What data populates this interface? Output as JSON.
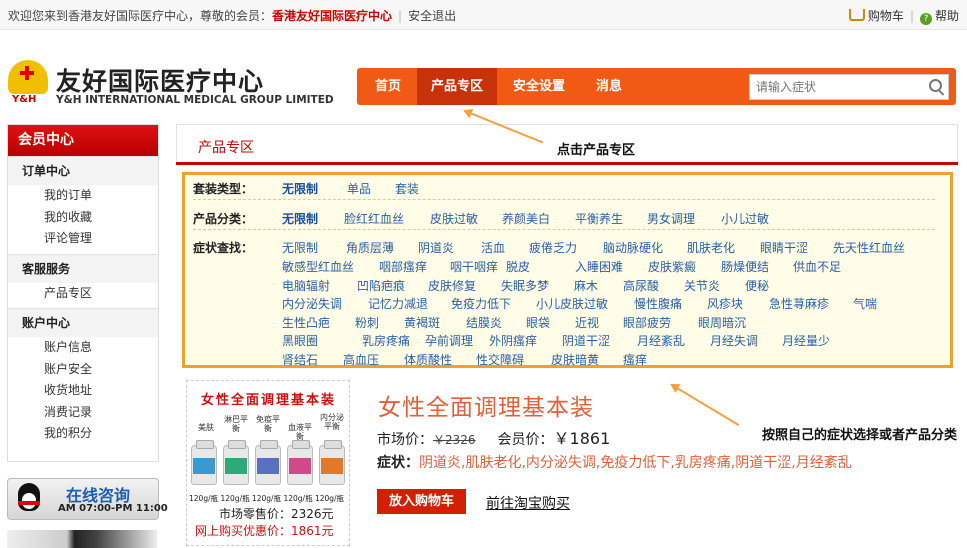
{
  "topbar": {
    "welcome": "欢迎您来到香港友好国际医疗中心，尊敬的会员：",
    "member": "香港友好国际医疗中心",
    "logout": "安全退出",
    "cart": "购物车",
    "help": "帮助",
    "cart_icon": "cart-icon",
    "help_icon": "help-icon"
  },
  "logo": {
    "cn": "友好国际医疗中心",
    "en": "Y&H INTERNATIONAL MEDICAL GROUP LIMITED",
    "mark": "Y&H"
  },
  "nav": {
    "tabs": [
      "首页",
      "产品专区",
      "安全设置",
      "消息"
    ],
    "active_tab": "产品专区",
    "search_placeholder": "请输入症状"
  },
  "sidebar": {
    "title": "会员中心",
    "sections": [
      {
        "title": "订单中心",
        "items": [
          "我的订单",
          "我的收藏",
          "评论管理"
        ]
      },
      {
        "title": "客服服务",
        "items": [
          "产品专区"
        ]
      },
      {
        "title": "账户中心",
        "items": [
          "账户信息",
          "账户安全",
          "收货地址",
          "消费记录",
          "我的积分"
        ]
      }
    ]
  },
  "consult": {
    "title": "在线咨询",
    "hours": "AM 07:00-PM 11:00"
  },
  "section": {
    "title": "产品专区"
  },
  "annotations": {
    "click_tab": "点击产品专区",
    "choose": "按照自己的症状选择或者产品分类"
  },
  "filters": {
    "package_type": {
      "label": "套装类型：",
      "options": [
        "无限制",
        "单品",
        "套装"
      ]
    },
    "category": {
      "label": "产品分类：",
      "options": [
        "无限制",
        "脸红红血丝",
        "皮肤过敏",
        "养颜美白",
        "平衡养生",
        "男女调理",
        "小儿过敏"
      ]
    },
    "symptom": {
      "label": "症状查找：",
      "rows": [
        [
          "无限制",
          "角质层薄",
          "阴道炎",
          "活血",
          "疲倦乏力",
          "脑动脉硬化",
          "肌肤老化",
          "眼睛干涩",
          "先天性红血丝"
        ],
        [
          "敏感型红血丝",
          "咽部瘙痒",
          "咽干咽痒",
          "脱皮",
          "入睡困难",
          "皮肤紫癜",
          "肠燥便结",
          "供血不足"
        ],
        [
          "电脑辐射",
          "凹陷疤痕",
          "皮肤修复",
          "失眠多梦",
          "麻木",
          "高尿酸",
          "关节炎",
          "便秘"
        ],
        [
          "内分泌失调",
          "记忆力减退",
          "免疫力低下",
          "小儿皮肤过敏",
          "慢性腹痛",
          "风疹块",
          "急性荨麻疹",
          "气喘"
        ],
        [
          "生性凸疤",
          "粉刺",
          "黄褐斑",
          "结膜炎",
          "眼袋",
          "近视",
          "眼部疲劳",
          "眼周暗沉"
        ],
        [
          "黑眼圈",
          "乳房疼痛",
          "孕前调理",
          "外阴瘙痒",
          "阴道干涩",
          "月经紊乱",
          "月经失调",
          "月经量少"
        ],
        [
          "肾结石",
          "高血压",
          "体质酸性",
          "性交障碍",
          "皮肤暗黄",
          "瘙痒"
        ]
      ]
    }
  },
  "product": {
    "image_title": "女性全面调理基本装",
    "bottle_labels": [
      "美肤",
      "淋巴平衡",
      "免疫平衡",
      "血液平衡",
      "内分泌平衡"
    ],
    "bottle_sizes": "120g/瓶 120g/瓶 120g/瓶 120g/瓶 120g/瓶",
    "image_market": "市场零售价：2326元",
    "image_online": "网上购买优惠价：1861元",
    "name": "女性全面调理基本装",
    "market_label": "市场价：",
    "market_price": "￥2326",
    "member_label": "会员价：",
    "member_price": "￥1861",
    "symptoms_label": "症状：",
    "symptoms": "阴道炎,肌肤老化,内分泌失调,免疫力低下,乳房疼痛,阴道干涩,月经紊乱",
    "buy_button": "放入购物车",
    "taobao_link": "前往淘宝购买"
  },
  "colors": {
    "nav": "#f05a14",
    "nav_active": "#c8320a",
    "accent_red": "#d40000",
    "filter_border": "#f0a030",
    "link_blue": "#2a5fa5",
    "product_name": "#e0603a"
  }
}
